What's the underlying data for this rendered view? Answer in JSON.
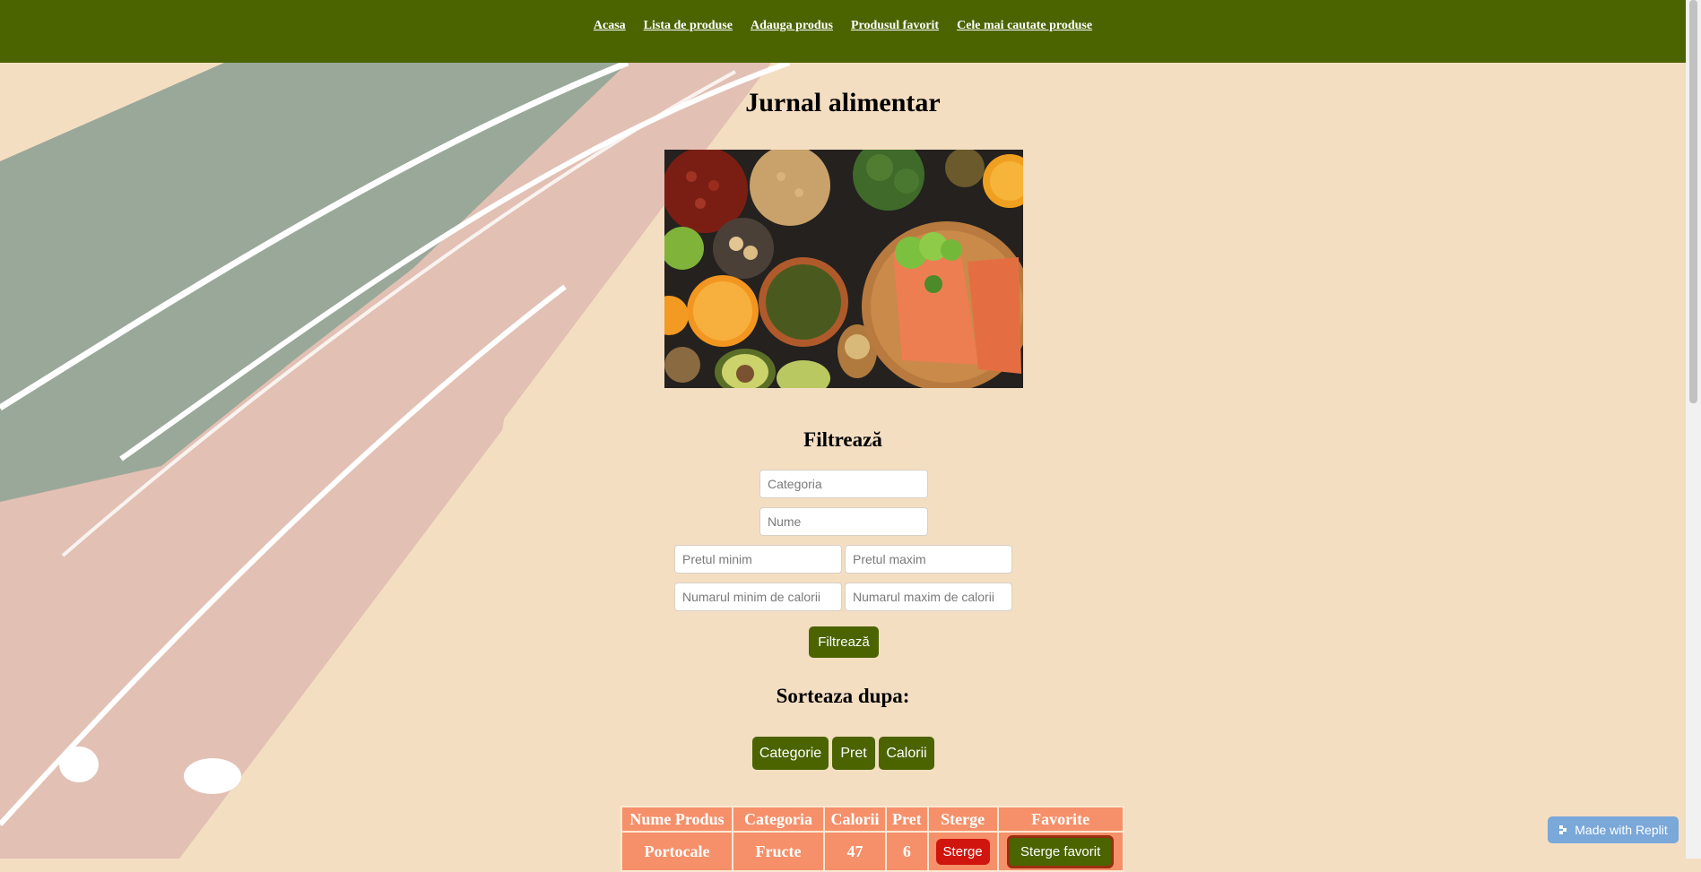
{
  "nav": {
    "items": [
      {
        "label": "Acasa"
      },
      {
        "label": "Lista de produse"
      },
      {
        "label": "Adauga produs"
      },
      {
        "label": "Produsul favorit"
      },
      {
        "label": "Cele mai cautate produse"
      }
    ]
  },
  "page_title": "Jurnal alimentar",
  "filter": {
    "heading": "Filtrează",
    "category_placeholder": "Categoria",
    "name_placeholder": "Nume",
    "min_price_placeholder": "Pretul minim",
    "max_price_placeholder": "Pretul maxim",
    "min_cal_placeholder": "Numarul minim de calorii",
    "max_cal_placeholder": "Numarul maxim de calorii",
    "button_label": "Filtrează"
  },
  "sort": {
    "heading": "Sorteaza dupa:",
    "buttons": [
      {
        "label": "Categorie"
      },
      {
        "label": "Pret"
      },
      {
        "label": "Calorii"
      }
    ]
  },
  "table": {
    "headers": [
      "Nume Produs",
      "Categoria",
      "Calorii",
      "Pret",
      "Sterge",
      "Favorite"
    ],
    "rows": [
      {
        "name": "Portocale",
        "category": "Fructe",
        "calories": "47",
        "price": "6",
        "delete_label": "Sterge",
        "fav_label": "Sterge favorit"
      }
    ]
  },
  "badge": {
    "label": "Made with Replit"
  },
  "colors": {
    "nav_bg": "#4b6400",
    "page_bg": "#f4dec2",
    "button": "#4b6400",
    "table_cell": "#f5906a",
    "delete_button": "#d0150e"
  }
}
